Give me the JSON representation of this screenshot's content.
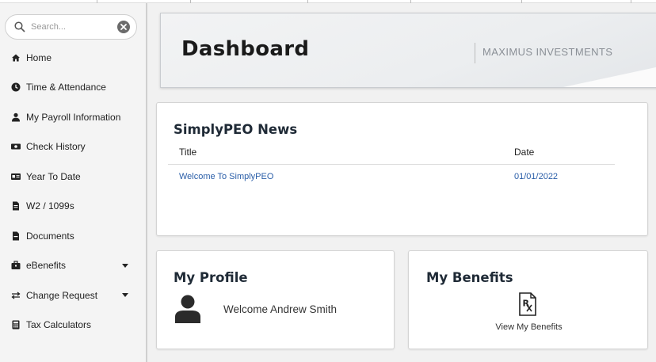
{
  "search": {
    "placeholder": "Search..."
  },
  "sidebar": {
    "items": [
      {
        "label": "Home",
        "icon": "home-icon"
      },
      {
        "label": "Time & Attendance",
        "icon": "clock-icon"
      },
      {
        "label": "My Payroll Information",
        "icon": "user-icon"
      },
      {
        "label": "Check History",
        "icon": "money-icon"
      },
      {
        "label": "Year To Date",
        "icon": "id-card-icon"
      },
      {
        "label": "W2 / 1099s",
        "icon": "file-icon"
      },
      {
        "label": "Documents",
        "icon": "document-icon"
      },
      {
        "label": "eBenefits",
        "icon": "briefcase-icon",
        "has_dropdown": true
      },
      {
        "label": "Change Request",
        "icon": "exchange-icon",
        "has_dropdown": true
      },
      {
        "label": "Tax Calculators",
        "icon": "calculator-icon"
      }
    ]
  },
  "header": {
    "title": "Dashboard",
    "company": "MAXIMUS INVESTMENTS"
  },
  "news": {
    "title": "SimplyPEO News",
    "columns": [
      "Title",
      "Date"
    ],
    "rows": [
      {
        "title": "Welcome To SimplyPEO",
        "date": "01/01/2022"
      }
    ]
  },
  "profile": {
    "title": "My Profile",
    "welcome": "Welcome Andrew Smith"
  },
  "benefits": {
    "title": "My Benefits",
    "link": "View My Benefits"
  },
  "colors": {
    "link": "#2a5ea8",
    "sidebar_bg": "#f4f4f4",
    "heading": "#1f2a36"
  }
}
